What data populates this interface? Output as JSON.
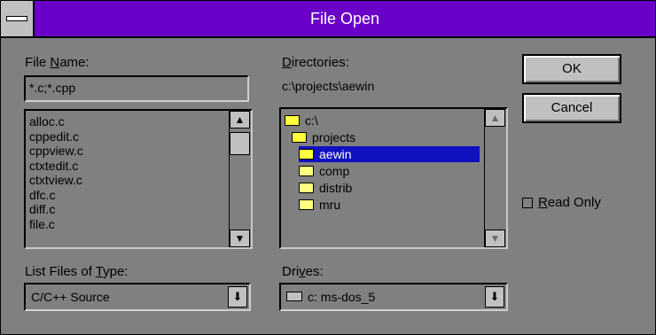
{
  "window": {
    "title": "File Open"
  },
  "file_name": {
    "label_pre": "File ",
    "label_accel": "N",
    "label_post": "ame:",
    "value": "*.c;*.cpp",
    "files": [
      "alloc.c",
      "cppedit.c",
      "cppview.c",
      "ctxtedit.c",
      "ctxtview.c",
      "dfc.c",
      "diff.c",
      "file.c"
    ]
  },
  "directories": {
    "label_accel": "D",
    "label_post": "irectories:",
    "current_path": "c:\\projects\\aewin",
    "items": [
      {
        "name": "c:\\",
        "indent": 0,
        "open": true
      },
      {
        "name": "projects",
        "indent": 1,
        "open": true
      },
      {
        "name": "aewin",
        "indent": 2,
        "open": true,
        "selected": true
      },
      {
        "name": "comp",
        "indent": 2,
        "open": false
      },
      {
        "name": "distrib",
        "indent": 2,
        "open": false
      },
      {
        "name": "mru",
        "indent": 2,
        "open": false
      }
    ]
  },
  "buttons": {
    "ok": "OK",
    "cancel": "Cancel"
  },
  "read_only": {
    "label_accel": "R",
    "label_post": "ead Only",
    "checked": false
  },
  "file_type": {
    "label_pre": "List Files of ",
    "label_accel": "T",
    "label_post": "ype:",
    "value": "C/C++ Source"
  },
  "drives": {
    "label_pre": "Dri",
    "label_accel": "v",
    "label_post": "es:",
    "value": "c: ms-dos_5"
  },
  "icons": {
    "scroll_up": "up-arrow-icon",
    "scroll_down": "down-arrow-icon",
    "folder": "folder-icon",
    "drive": "hard-drive-icon"
  }
}
